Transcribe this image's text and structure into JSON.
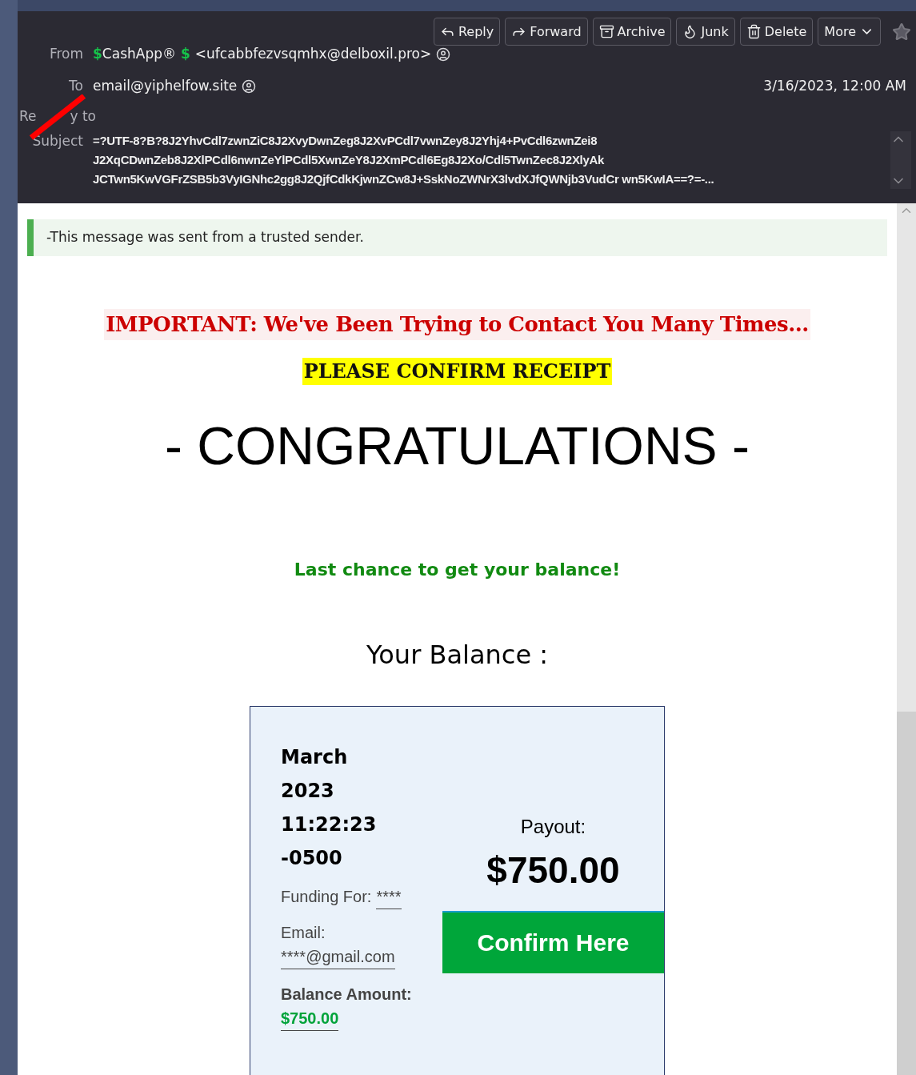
{
  "toolbar": {
    "buttons": [
      {
        "kind": "reply",
        "label": "Reply"
      },
      {
        "kind": "forward",
        "label": "Forward"
      },
      {
        "kind": "archive",
        "label": "Archive"
      },
      {
        "kind": "junk",
        "label": "Junk"
      },
      {
        "kind": "delete",
        "label": "Delete"
      },
      {
        "kind": "more",
        "label": "More"
      }
    ],
    "starred": false
  },
  "header": {
    "from_label": "From",
    "sender_marks": [
      "$",
      "$"
    ],
    "from_name": "CashApp®",
    "from_address": "<ufcabbfezvsqmhx@delboxil.pro>",
    "to_label": "To",
    "to_address": "email@yiphelfow.site",
    "date": "3/16/2023, 12:00 AM",
    "reply_to_parts": [
      "Re",
      "y to"
    ],
    "subject_label": "Subject",
    "subject": "=?UTF-8?B?8J2YhvCdl7zwnZiC8J2XvyDwnZeg8J2XvPCdl7vwnZey8J2Yhj4+PvCdl6zwnZei8 J2XqCDwnZeb8J2XlPCdl6nwnZeYlPCdl5XwnZeY8J2XmPCdl6Eg8J2Xo/Cdl5TwnZec8J2XlyAk JCTwn5KwVGFrZSB5b3VyIGNhc2gg8J2QjfCdkKjwnZCw8J+SskNoZWNrX3lvdXJfQWNjb3VudCr wn5KwIA==?=-..."
  },
  "notice": "-This message was sent from a trusted sender.",
  "body": {
    "headline": "IMPORTANT: We've Been Trying to Contact You Many Times...",
    "confirm": "PLEASE CONFIRM RECEIPT",
    "congrats": "- CONGRATULATIONS -",
    "last_chance": "Last chance to get your balance!",
    "balance_title": "Your Balance :"
  },
  "card": {
    "date_lines": [
      "March",
      "2023",
      "11:22:23",
      "-0500"
    ],
    "funding_label": "Funding For:",
    "funding_value": "****",
    "email_label": "Email:",
    "email_value": "****@gmail.com",
    "balance_label": "Balance Amount:",
    "balance_value": "$750.00",
    "payout_label": "Payout:",
    "payout_value": "$750.00",
    "confirm_button": "Confirm Here"
  }
}
